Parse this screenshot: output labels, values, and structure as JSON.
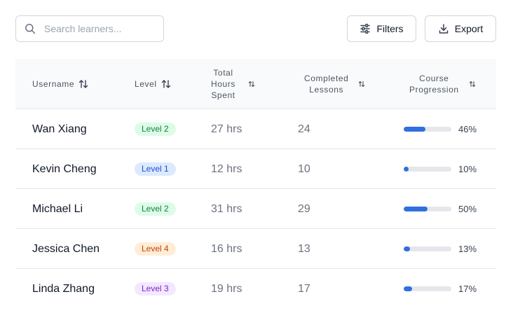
{
  "toolbar": {
    "search_placeholder": "Search learners...",
    "filters_label": "Filters",
    "export_label": "Export"
  },
  "table": {
    "headers": {
      "username": "Username",
      "level": "Level",
      "hours": [
        "Total",
        "Hours",
        "Spent"
      ],
      "lessons": [
        "Completed",
        "Lessons"
      ],
      "progression": [
        "Course",
        "Progression"
      ]
    },
    "rows": [
      {
        "username": "Wan Xiang",
        "level": "Level 2",
        "level_key": "2",
        "hours": "27 hrs",
        "lessons": "24",
        "progress": 46,
        "progress_label": "46%"
      },
      {
        "username": "Kevin Cheng",
        "level": "Level 1",
        "level_key": "1",
        "hours": "12 hrs",
        "lessons": "10",
        "progress": 10,
        "progress_label": "10%"
      },
      {
        "username": "Michael Li",
        "level": "Level 2",
        "level_key": "2",
        "hours": "31 hrs",
        "lessons": "29",
        "progress": 50,
        "progress_label": "50%"
      },
      {
        "username": "Jessica Chen",
        "level": "Level 4",
        "level_key": "4",
        "hours": "16 hrs",
        "lessons": "13",
        "progress": 13,
        "progress_label": "13%"
      },
      {
        "username": "Linda Zhang",
        "level": "Level 3",
        "level_key": "3",
        "hours": "19 hrs",
        "lessons": "17",
        "progress": 17,
        "progress_label": "17%"
      }
    ]
  },
  "level_colors": {
    "1": {
      "bg": "#dbeafe",
      "fg": "#1d4ed8"
    },
    "2": {
      "bg": "#dcfce7",
      "fg": "#15803d"
    },
    "3": {
      "bg": "#f3e8ff",
      "fg": "#7e22ce"
    },
    "4": {
      "bg": "#ffedd5",
      "fg": "#c2410c"
    }
  },
  "colors": {
    "progress_fill": "#2f6fe0",
    "progress_track": "#e5e7eb"
  }
}
